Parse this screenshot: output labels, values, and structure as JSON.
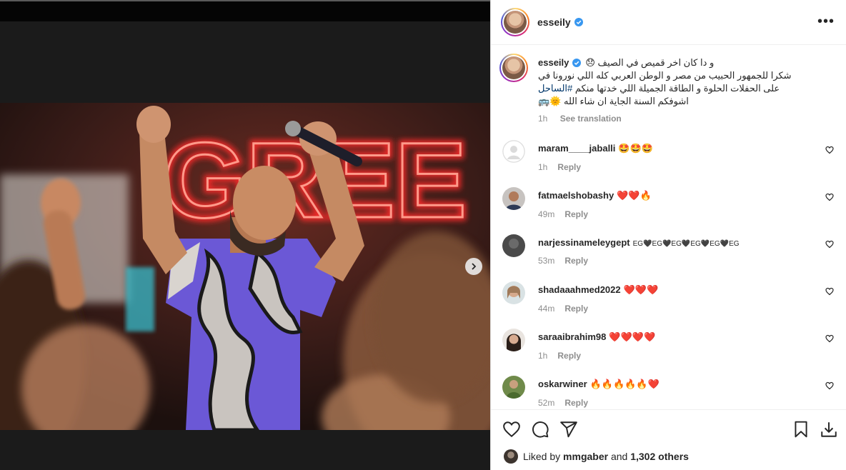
{
  "media": {
    "sign_text": "GREE",
    "next_label": "›"
  },
  "post": {
    "username": "esseily",
    "more_label": "•••",
    "caption": {
      "line1": "و دا كان اخر قميص في الصيف 😞",
      "line2": "شكرا للجمهور الحبيب من مصر و الوطن العربي كله اللي نورونا في",
      "hashtag": "#الساحل",
      "line3_rest": "على الحفلات الحلوة و الطاقة الجميلة اللي خدتها منكم",
      "line4": "اشوفكم السنة الجاية ان شاء الله 🌞🚌",
      "time": "1h",
      "see_translation": "See translation"
    },
    "comments": [
      {
        "user": "maram____jaballi",
        "text": "🤩🤩🤩",
        "time": "1h",
        "reply": "Reply"
      },
      {
        "user": "fatmaelshobashy",
        "text": "❤️❤️🔥",
        "time": "49m",
        "reply": "Reply"
      },
      {
        "user": "narjessinameleygept",
        "text": "EG🖤EG🖤EG🖤EG🖤EG🖤EG",
        "time": "53m",
        "reply": "Reply"
      },
      {
        "user": "shadaaahmed2022",
        "text": "❤️❤️❤️",
        "time": "44m",
        "reply": "Reply"
      },
      {
        "user": "saraaibrahim98",
        "text": "❤️❤️❤️❤️",
        "time": "1h",
        "reply": "Reply"
      },
      {
        "user": "oskarwiner",
        "text": "🔥🔥🔥🔥🔥❤️",
        "time": "52m",
        "reply": "Reply"
      }
    ],
    "likes": {
      "prefix": "Liked by",
      "user": "mmgaber",
      "middle": "and",
      "count": "1,302 others"
    }
  },
  "colors": {
    "verified": "#3897f0",
    "text": "#262626",
    "secondary": "#8e8e8e",
    "neon": "#ff2a2a"
  },
  "icons": [
    "verified-icon",
    "more-icon",
    "chevron-right-icon",
    "heart-icon",
    "comment-icon",
    "share-icon",
    "bookmark-icon",
    "download-icon",
    "heart-outline-icon"
  ]
}
